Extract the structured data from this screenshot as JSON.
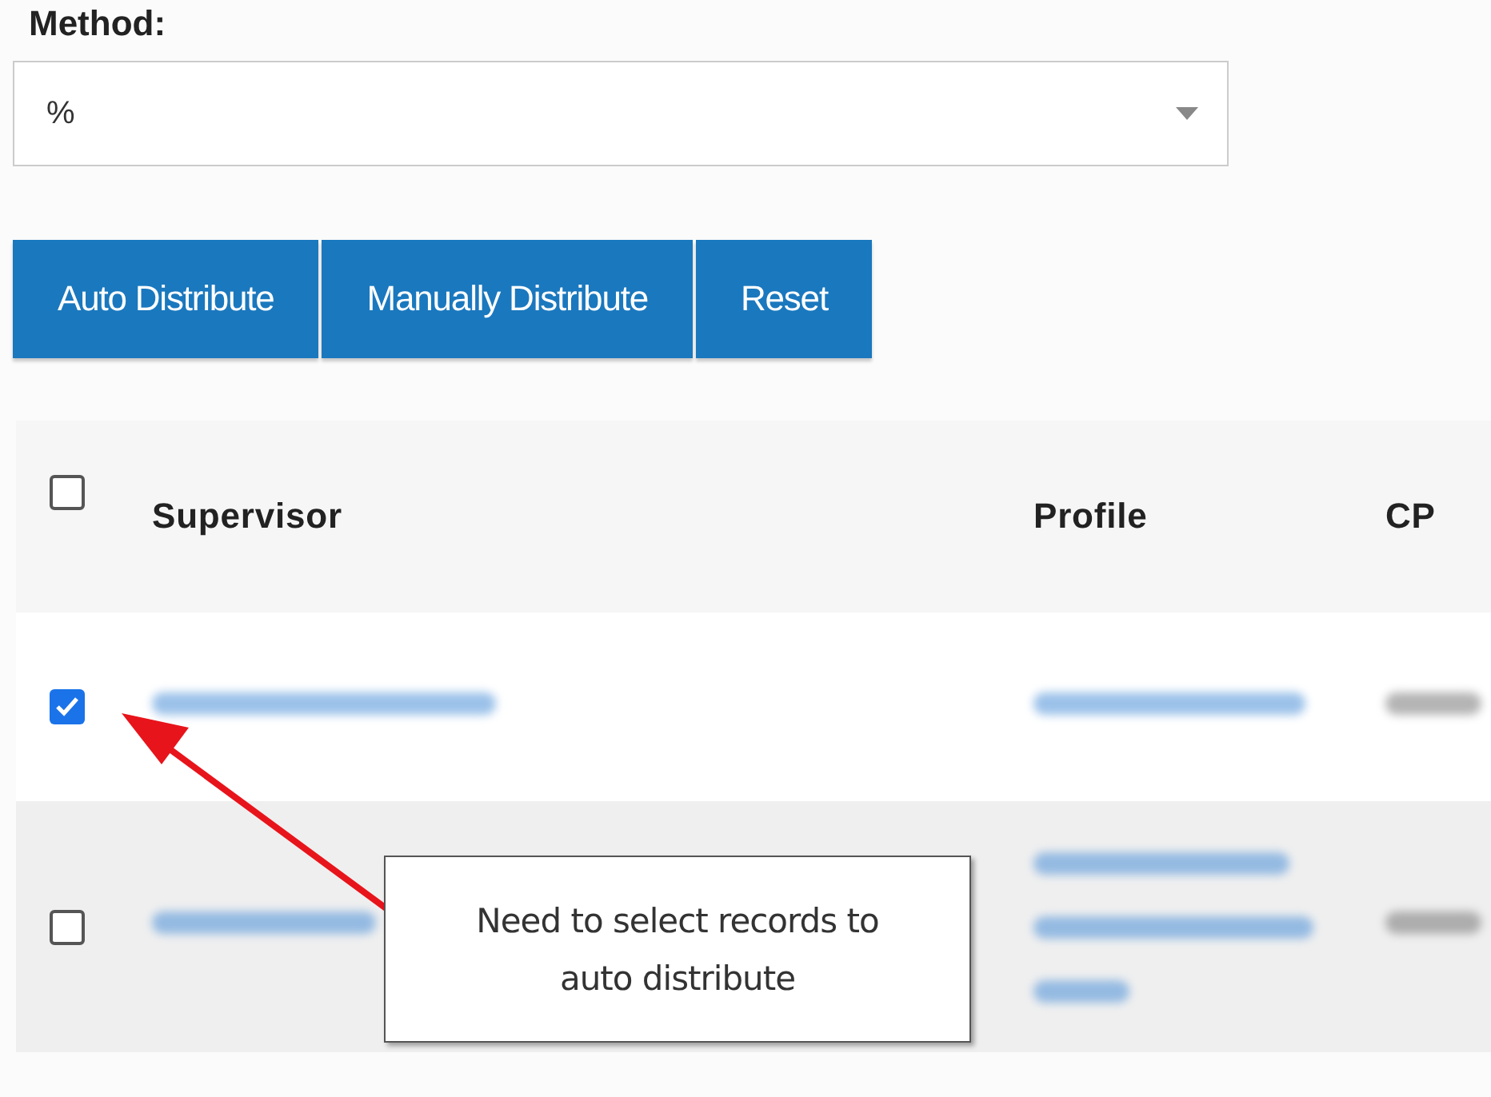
{
  "method": {
    "label": "Method:",
    "value": "%"
  },
  "buttons": [
    "Auto Distribute",
    "Manually Distribute",
    "Reset"
  ],
  "table": {
    "select_all_checked": false,
    "columns": [
      "Supervisor",
      "Profile",
      "CP"
    ],
    "rows": [
      {
        "checked": true
      },
      {
        "checked": false
      }
    ]
  },
  "callout": {
    "text": "Need to select records to auto distribute"
  }
}
